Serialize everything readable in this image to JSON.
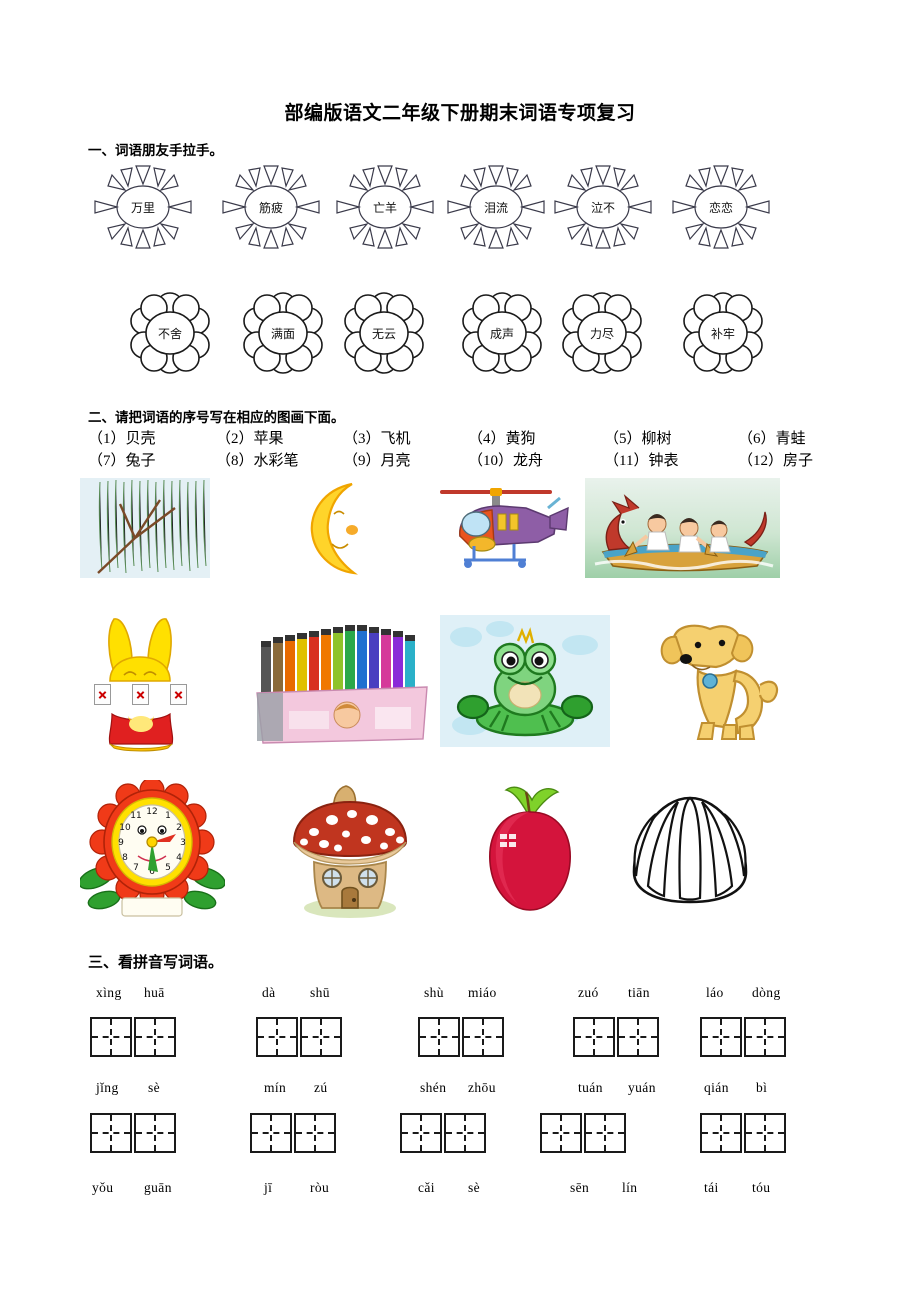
{
  "document": {
    "title": "部编版语文二年级下册期末词语专项复习"
  },
  "sections": {
    "one": {
      "heading": "一、词语朋友手拉手。",
      "suns": [
        {
          "text": "万里",
          "icon": "sun-icon"
        },
        {
          "text": "筋疲",
          "icon": "sun-icon"
        },
        {
          "text": "亡羊",
          "icon": "sun-icon"
        },
        {
          "text": "泪流",
          "icon": "sun-icon"
        },
        {
          "text": "泣不",
          "icon": "sun-icon"
        },
        {
          "text": "恋恋",
          "icon": "sun-icon"
        }
      ],
      "flowers": [
        {
          "text": "不舍",
          "icon": "flower-icon"
        },
        {
          "text": "满面",
          "icon": "flower-icon"
        },
        {
          "text": "无云",
          "icon": "flower-icon"
        },
        {
          "text": "成声",
          "icon": "flower-icon"
        },
        {
          "text": "力尽",
          "icon": "flower-icon"
        },
        {
          "text": "补牢",
          "icon": "flower-icon"
        }
      ]
    },
    "two": {
      "heading": "二、请把词语的序号写在相应的图画下面。",
      "words_row1": [
        "（1）贝壳",
        "（2）苹果",
        "（3）飞机",
        "（4）黄狗",
        "（5）柳树",
        "（6）青蛙"
      ],
      "words_row2": [
        "（7）兔子",
        "（8）水彩笔",
        "（9）月亮",
        "（10）龙舟",
        "（11）钟表",
        "（12）房子"
      ],
      "pictures_row1": [
        {
          "name": "willow-tree-picture"
        },
        {
          "name": "crescent-moon-picture"
        },
        {
          "name": "helicopter-picture"
        },
        {
          "name": "dragon-boat-picture"
        }
      ],
      "pictures_row2": [
        {
          "name": "rabbit-picture"
        },
        {
          "name": "color-markers-picture"
        },
        {
          "name": "frog-picture"
        },
        {
          "name": "yellow-dog-picture"
        }
      ],
      "pictures_row3": [
        {
          "name": "flower-clock-picture"
        },
        {
          "name": "mushroom-house-picture"
        },
        {
          "name": "red-apple-picture"
        },
        {
          "name": "seashell-picture"
        }
      ],
      "clock_numbers": [
        "12",
        "1",
        "2",
        "3",
        "4",
        "5",
        "6",
        "7",
        "8",
        "9",
        "10",
        "11"
      ]
    },
    "three": {
      "heading": "三、看拼音写词语。",
      "rows": [
        {
          "items": [
            {
              "syl1": "xìng",
              "syl2": "huā"
            },
            {
              "syl1": "dà",
              "syl2": "shū"
            },
            {
              "syl1": "shù",
              "syl2": "miáo"
            },
            {
              "syl1": "zuó",
              "syl2": "tiān"
            },
            {
              "syl1": "láo",
              "syl2": "dòng"
            }
          ]
        },
        {
          "items": [
            {
              "syl1": "jǐng",
              "syl2": "sè"
            },
            {
              "syl1": "mín",
              "syl2": "zú"
            },
            {
              "syl1": "shén",
              "syl2": "zhōu"
            },
            {
              "syl1": "tuán",
              "syl2": "yuán"
            },
            {
              "syl1": "qián",
              "syl2": "bì"
            }
          ]
        },
        {
          "items": [
            {
              "syl1": "yǒu",
              "syl2": "guān"
            },
            {
              "syl1": "jī",
              "syl2": "ròu"
            },
            {
              "syl1": "cǎi",
              "syl2": "sè"
            },
            {
              "syl1": "sēn",
              "syl2": "lín"
            },
            {
              "syl1": "tái",
              "syl2": "tóu"
            }
          ]
        }
      ]
    }
  },
  "colors": {
    "ink": "#000000",
    "sun_outline": "#3a3a4a",
    "flower_outline": "#1a1a1a",
    "moon_yellow": "#ffd42a",
    "apple_red": "#d4143c",
    "dog_yellow": "#f2c75c",
    "frog_green": "#5cb85c",
    "broken_x": "#cc0000"
  }
}
